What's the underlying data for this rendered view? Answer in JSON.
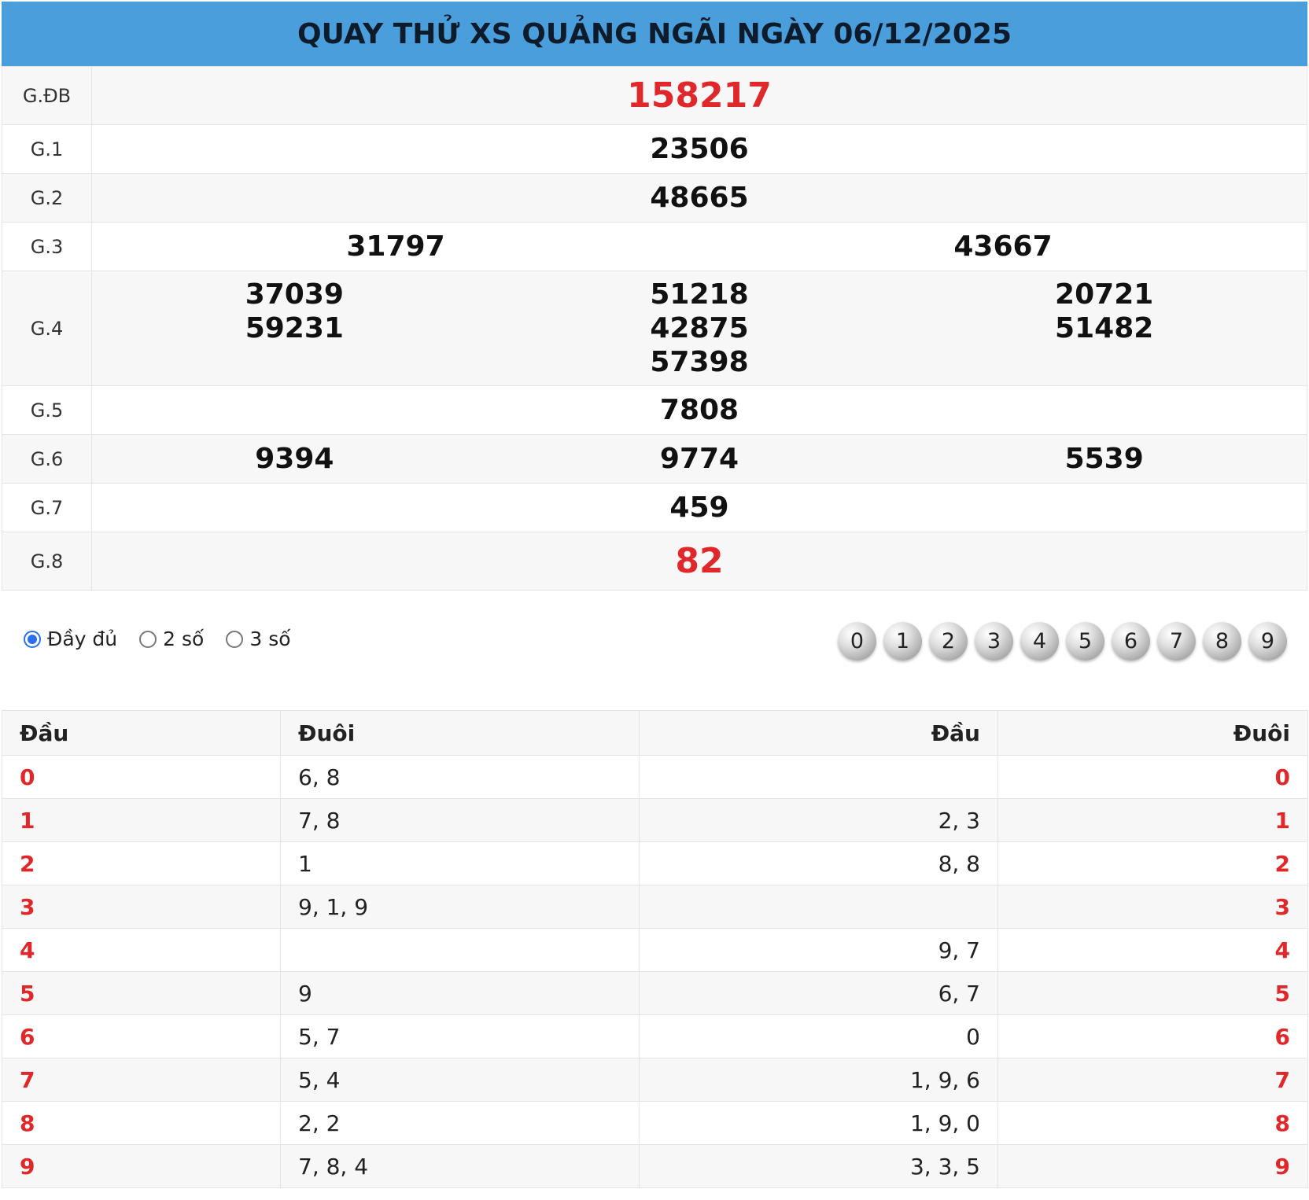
{
  "title": "QUAY THỬ XS QUẢNG NGÃI NGÀY 06/12/2025",
  "prizes": [
    {
      "label": "G.ĐB",
      "values": [
        "158217"
      ]
    },
    {
      "label": "G.1",
      "values": [
        "23506"
      ]
    },
    {
      "label": "G.2",
      "values": [
        "48665"
      ]
    },
    {
      "label": "G.3",
      "values": [
        "31797",
        "43667"
      ]
    },
    {
      "label": "G.4",
      "col1": [
        "37039",
        "59231"
      ],
      "col2": [
        "51218",
        "42875",
        "57398"
      ],
      "col3": [
        "20721",
        "51482"
      ]
    },
    {
      "label": "G.5",
      "values": [
        "7808"
      ]
    },
    {
      "label": "G.6",
      "values": [
        "9394",
        "9774",
        "5539"
      ]
    },
    {
      "label": "G.7",
      "values": [
        "459"
      ]
    },
    {
      "label": "G.8",
      "values": [
        "82"
      ]
    }
  ],
  "filter": {
    "options": [
      "Đầy đủ",
      "2 số",
      "3 số"
    ],
    "selected": "Đầy đủ"
  },
  "digit_buttons": [
    "0",
    "1",
    "2",
    "3",
    "4",
    "5",
    "6",
    "7",
    "8",
    "9"
  ],
  "colors": {
    "header_bg": "#4a9edb",
    "highlight_red": "#e0282a"
  },
  "loto": {
    "headers": [
      "Đầu",
      "Đuôi",
      "Đầu",
      "Đuôi"
    ],
    "rows": [
      {
        "head": "0",
        "tails": "6, 8",
        "heads": "",
        "tail": "0"
      },
      {
        "head": "1",
        "tails": "7, 8",
        "heads": "2, 3",
        "tail": "1"
      },
      {
        "head": "2",
        "tails": "1",
        "heads": "8, 8",
        "tail": "2"
      },
      {
        "head": "3",
        "tails": "9, 1, 9",
        "heads": "",
        "tail": "3"
      },
      {
        "head": "4",
        "tails": "",
        "heads": "9, 7",
        "tail": "4"
      },
      {
        "head": "5",
        "tails": "9",
        "heads": "6, 7",
        "tail": "5"
      },
      {
        "head": "6",
        "tails": "5, 7",
        "heads": "0",
        "tail": "6"
      },
      {
        "head": "7",
        "tails": "5, 4",
        "heads": "1, 9, 6",
        "tail": "7"
      },
      {
        "head": "8",
        "tails": "2, 2",
        "heads": "1, 9, 0",
        "tail": "8"
      },
      {
        "head": "9",
        "tails": "7, 8, 4",
        "heads": "3, 3, 5",
        "tail": "9"
      }
    ]
  }
}
